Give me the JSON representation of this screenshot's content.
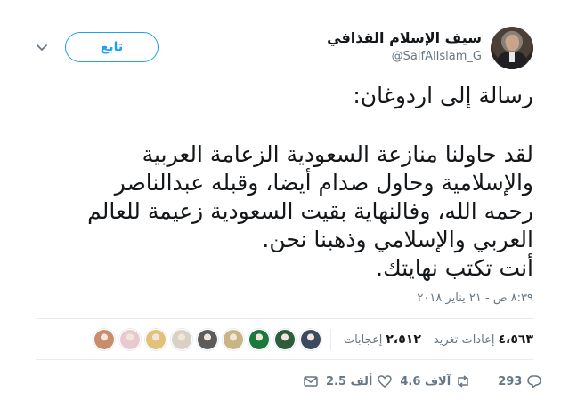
{
  "header": {
    "display_name": "سيف الإسلام القذافي",
    "handle": "@SaifAlIslam_G",
    "follow_label": "تابع"
  },
  "tweet": {
    "lines": [
      "رسالة إلى اردوغان:",
      "لقد حاولنا منازعة السعودية الزعامة العربية",
      "والإسلامية وحاول صدام أيضا، وقبله عبدالناصر",
      "رحمه الله، وفالنهاية بقيت السعودية زعيمة للعالم",
      "العربي والإسلامي وذهبنا نحن.",
      "أنت تكتب نهايتك."
    ],
    "timestamp": "٨:٣٩ ص - ٢١ يناير ٢٠١٨"
  },
  "stats": {
    "retweets_count": "٤،٥٦٣",
    "retweets_label": "إعادات تغريد",
    "likes_count": "٢،٥١٢",
    "likes_label": "إعجابات"
  },
  "likers": [
    {
      "icon": "liker-avatar",
      "color": "#3b4a5e"
    },
    {
      "icon": "liker-avatar",
      "color": "#2f5d3b"
    },
    {
      "icon": "liker-avatar",
      "color": "#1a7a3c"
    },
    {
      "icon": "liker-avatar",
      "color": "#c9b486"
    },
    {
      "icon": "liker-avatar",
      "color": "#5c5c5c"
    },
    {
      "icon": "liker-avatar",
      "color": "#d9d2c4"
    },
    {
      "icon": "liker-avatar",
      "color": "#e2c27a"
    },
    {
      "icon": "liker-avatar",
      "color": "#e9c9cf"
    },
    {
      "icon": "liker-avatar",
      "color": "#c98c6c"
    }
  ],
  "actions": {
    "reply_count": "293",
    "retweet_count": "4.6 آلاف",
    "like_count": "2.5 ألف"
  },
  "colors": {
    "accent": "#1da1f2",
    "muted": "#657786",
    "text": "#14171a"
  }
}
